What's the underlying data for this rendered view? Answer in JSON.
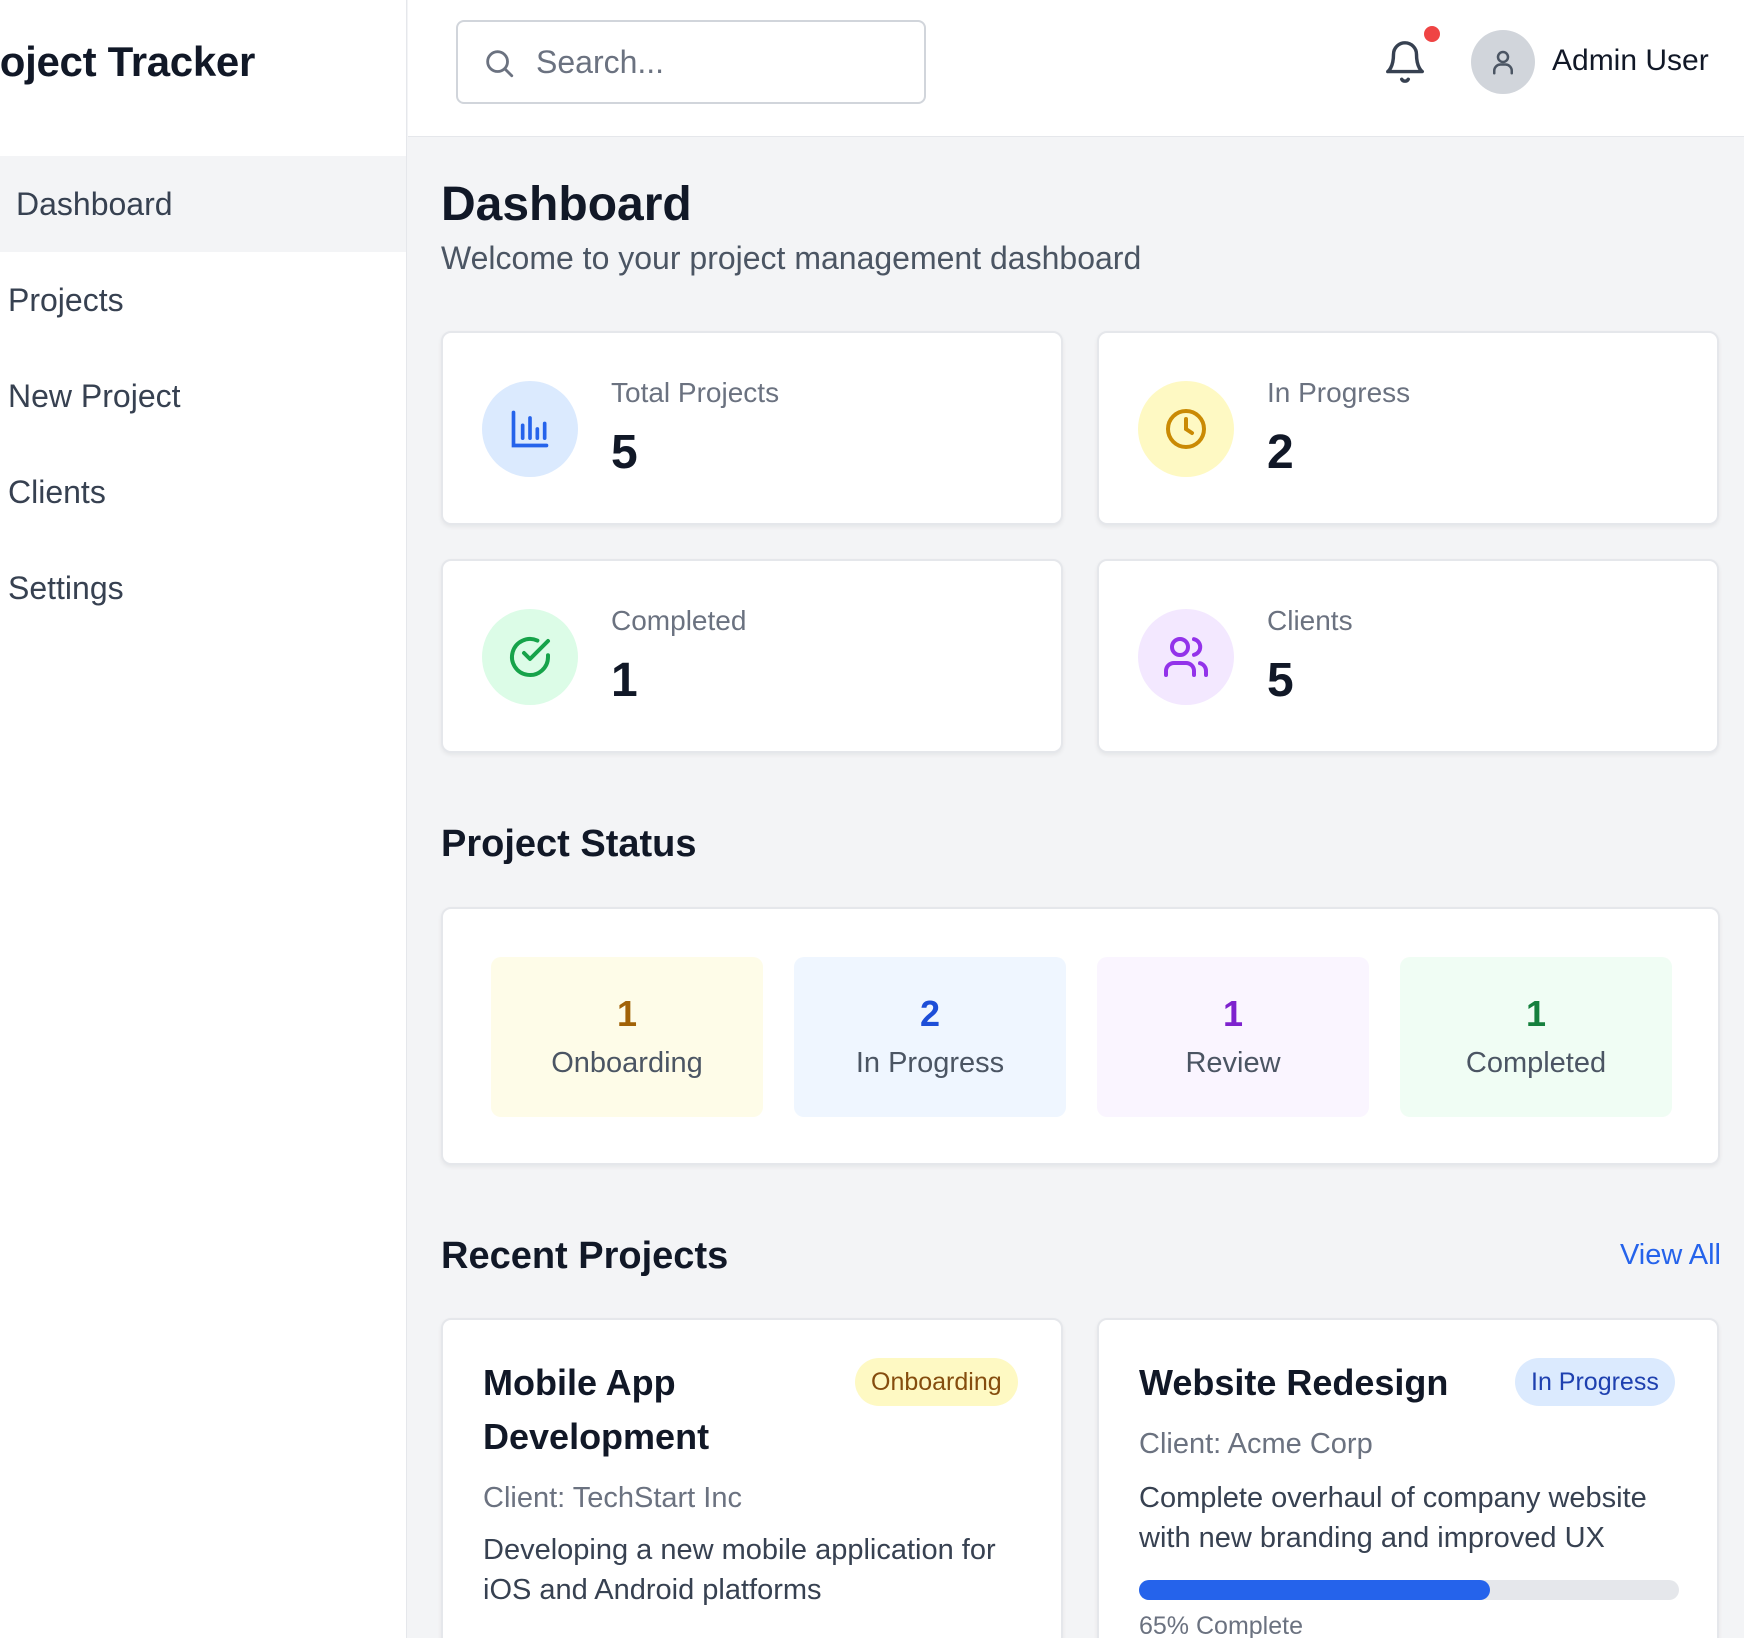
{
  "app": {
    "title": "Project Tracker"
  },
  "sidebar": {
    "items": [
      {
        "label": "Dashboard",
        "active": true
      },
      {
        "label": "Projects",
        "active": false
      },
      {
        "label": "New Project",
        "active": false
      },
      {
        "label": "Clients",
        "active": false
      },
      {
        "label": "Settings",
        "active": false
      }
    ]
  },
  "header": {
    "search": {
      "placeholder": "Search...",
      "icon": "search-icon"
    },
    "notifications": {
      "icon": "bell-icon",
      "has_unread": true
    },
    "user": {
      "name": "Admin User",
      "icon": "user-icon"
    }
  },
  "page": {
    "title": "Dashboard",
    "subtitle": "Welcome to your project management dashboard"
  },
  "stats": [
    {
      "label": "Total Projects",
      "value": "5",
      "icon": "bar-chart-icon",
      "bg": "#dbeafe",
      "fg": "#2563eb"
    },
    {
      "label": "In Progress",
      "value": "2",
      "icon": "clock-icon",
      "bg": "#fef9c3",
      "fg": "#ca8a04"
    },
    {
      "label": "Completed",
      "value": "1",
      "icon": "check-circle-icon",
      "bg": "#dcfce7",
      "fg": "#16a34a"
    },
    {
      "label": "Clients",
      "value": "5",
      "icon": "users-icon",
      "bg": "#f3e8ff",
      "fg": "#9333ea"
    }
  ],
  "project_status": {
    "title": "Project Status",
    "tiles": [
      {
        "count": "1",
        "label": "Onboarding",
        "bg": "#fefce8",
        "fg": "#a16207"
      },
      {
        "count": "2",
        "label": "In Progress",
        "bg": "#eff6ff",
        "fg": "#1d4ed8"
      },
      {
        "count": "1",
        "label": "Review",
        "bg": "#faf5ff",
        "fg": "#7e22ce"
      },
      {
        "count": "1",
        "label": "Completed",
        "bg": "#f0fdf4",
        "fg": "#15803d"
      }
    ]
  },
  "recent_projects": {
    "title": "Recent Projects",
    "view_all_label": "View All",
    "items": [
      {
        "title": "Mobile App Development",
        "status": "Onboarding",
        "badge_bg": "#fef9c3",
        "badge_fg": "#854d0e",
        "client": "Client: TechStart Inc",
        "description": "Developing a new mobile application for iOS and Android platforms"
      },
      {
        "title": "Website Redesign",
        "status": "In Progress",
        "badge_bg": "#dbeafe",
        "badge_fg": "#1e40af",
        "client": "Client: Acme Corp",
        "description": "Complete overhaul of company website with new branding and improved UX",
        "progress": 0.65,
        "progress_label": "65% Complete"
      }
    ]
  }
}
